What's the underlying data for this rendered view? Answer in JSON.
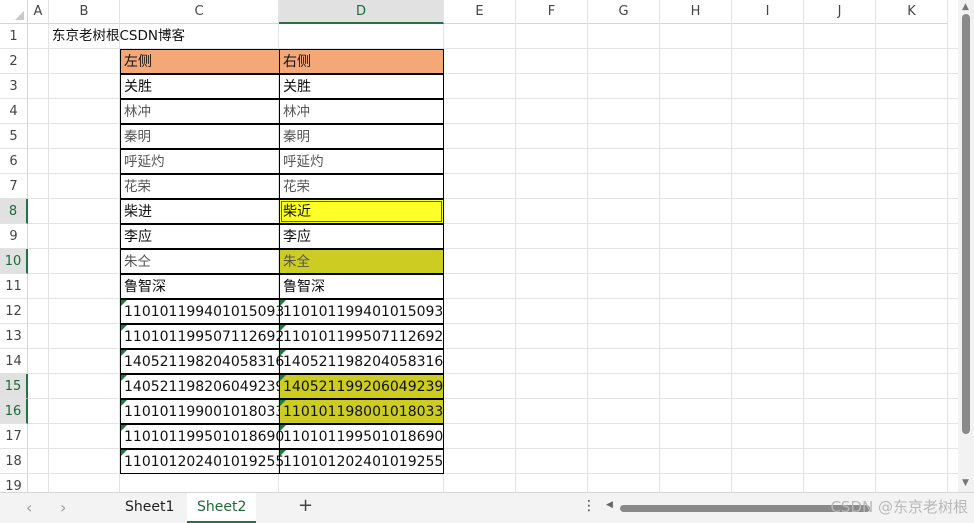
{
  "columns": [
    "A",
    "B",
    "C",
    "D",
    "E",
    "F",
    "G",
    "H",
    "I",
    "J",
    "K"
  ],
  "selected_column": "D",
  "rows": [
    "1",
    "2",
    "3",
    "4",
    "5",
    "6",
    "7",
    "8",
    "9",
    "10",
    "11",
    "12",
    "13",
    "14",
    "15",
    "16",
    "17",
    "18",
    "19"
  ],
  "selected_rows": [
    "8",
    "10",
    "15",
    "16"
  ],
  "title_cell": "东京老树根CSDN博客",
  "headers": {
    "left": "左侧",
    "right": "右侧"
  },
  "left_values": [
    "关胜",
    "林冲",
    "秦明",
    "呼延灼",
    "花荣",
    "柴进",
    "李应",
    "朱仝",
    "鲁智深",
    "110101199401015093",
    "110101199507112692",
    "140521198204058316",
    "140521198206049239",
    "110101199001018033",
    "110101199501018690",
    "110101202401019255"
  ],
  "right_values": [
    "关胜",
    "林冲",
    "秦明",
    "呼延灼",
    "花荣",
    "柴近",
    "李应",
    "朱全",
    "鲁智深",
    "110101199401015093",
    "110101199507112692",
    "140521198204058316",
    "140521199206049239",
    "110101198001018033",
    "110101199501018690",
    "110101202401019255"
  ],
  "sheet_tabs": [
    "Sheet1",
    "Sheet2"
  ],
  "active_tab": "Sheet2",
  "watermark": "CSDN @东京老树根",
  "colors": {
    "header_fill": "#f4a777",
    "highlight_yellow": "#ffff28",
    "highlight_olive": "#cccc22",
    "accent": "#217346"
  }
}
